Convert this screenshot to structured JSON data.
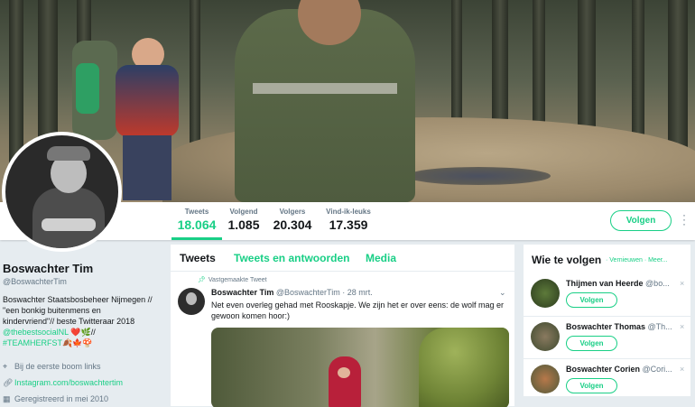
{
  "nav": {
    "stats": [
      {
        "label": "Tweets",
        "value": "18.064",
        "active": true
      },
      {
        "label": "Volgend",
        "value": "1.085"
      },
      {
        "label": "Volgers",
        "value": "20.304"
      },
      {
        "label": "Vind-ik-leuks",
        "value": "17.359"
      }
    ],
    "follow_label": "Volgen",
    "more_icon": "more-vertical-icon"
  },
  "profile": {
    "name": "Boswachter Tim",
    "handle": "@BoswachterTim",
    "bio_line1": "Boswachter Staatsbosbeheer Nijmegen //",
    "bio_line2": "\"een bonkig buitenmens en",
    "bio_line3": "kindervriend\"// beste Twitteraar 2018",
    "bio_link": "@thebestsocialNL",
    "bio_emoji1": "❤️🌿//",
    "bio_hashtag": "#TEAMHERFST",
    "bio_emoji2": "🍂🍁🍄",
    "location": "Bij de eerste boom links",
    "website": "Instagram.com/boswachtertim",
    "joined": "Geregistreerd in mei 2010",
    "accent": "#19cf86"
  },
  "timeline": {
    "tabs": [
      "Tweets",
      "Tweets en antwoorden",
      "Media"
    ],
    "pinned_label": "Vastgemaakte Tweet",
    "tweet": {
      "name": "Boswachter Tim",
      "handle": "@BoswachterTim · 28 mrt.",
      "text": "Net even overleg gehad met Rooskapje. We zijn het er over eens: de wolf mag er gewoon komen hoor:)"
    }
  },
  "who_to_follow": {
    "title": "Wie te volgen",
    "refresh": "· Vernieuwen",
    "more": "· Meer...",
    "follow_label": "Volgen",
    "close_glyph": "×",
    "items": [
      {
        "name": "Thijmen van Heerde",
        "handle": "@bo..."
      },
      {
        "name": "Boswachter Thomas",
        "handle": "@Th..."
      },
      {
        "name": "Boswachter Corien",
        "handle": "@Cori..."
      }
    ]
  }
}
